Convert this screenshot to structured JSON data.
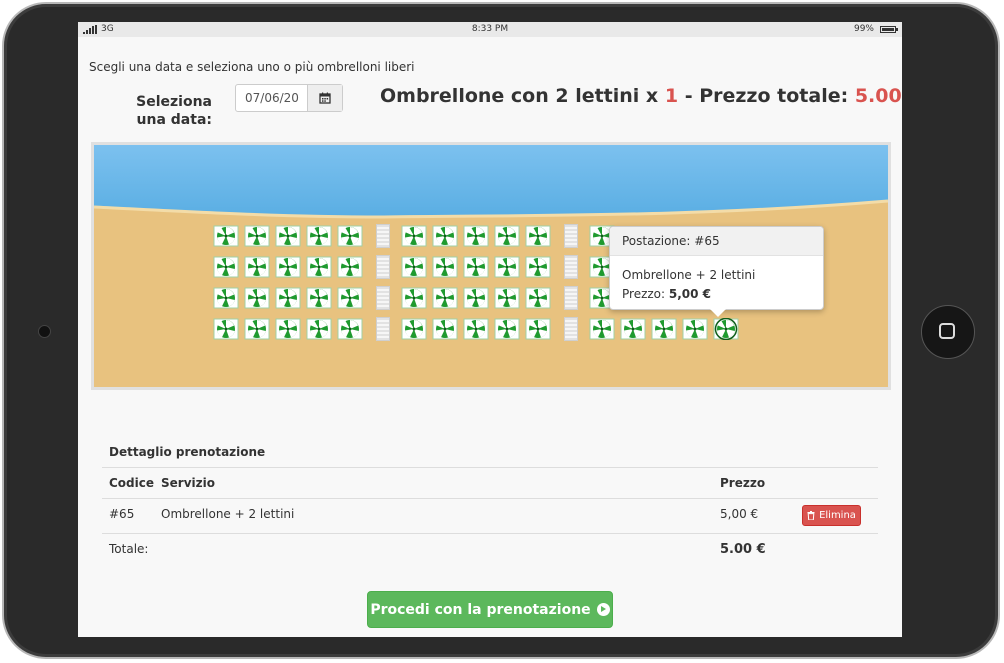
{
  "status_bar": {
    "network": "3G",
    "time": "8:33 PM",
    "battery": "99%"
  },
  "booking": {
    "intro": "Scegli una data e seleziona uno o più ombrelloni liberi",
    "date_label": "Seleziona una data:",
    "date_value": "07/06/20",
    "headline_prefix": "Ombrellone con 2 lettini x",
    "quantity": "1",
    "headline_mid": "- Prezzo totale:",
    "total_price": "5.00",
    "currency": "€"
  },
  "tooltip": {
    "title": "Postazione: #65",
    "service": "Ombrellone + 2 lettini",
    "price_label": "Prezzo:",
    "price_value": "5,00 €"
  },
  "detail": {
    "title": "Dettaglio prenotazione",
    "columns": {
      "code": "Codice",
      "service": "Servizio",
      "price": "Prezzo"
    },
    "row": {
      "code": "#65",
      "service": "Ombrellone + 2 lettini",
      "price": "5,00 €",
      "delete_label": "Elimina"
    },
    "total_label": "Totale:",
    "total_value": "5.00 €"
  },
  "proceed_label": "Procedi con la prenotazione",
  "icons": [
    "calendar-icon",
    "trash-icon",
    "arrow-circle-right-icon",
    "umbrella-icon"
  ],
  "colors": {
    "accent_red": "#d9534f",
    "success_green": "#5cb85c",
    "sand": "#e8c27f",
    "sea": "#66b3e6",
    "umbrella_green": "#1f9a2f"
  }
}
